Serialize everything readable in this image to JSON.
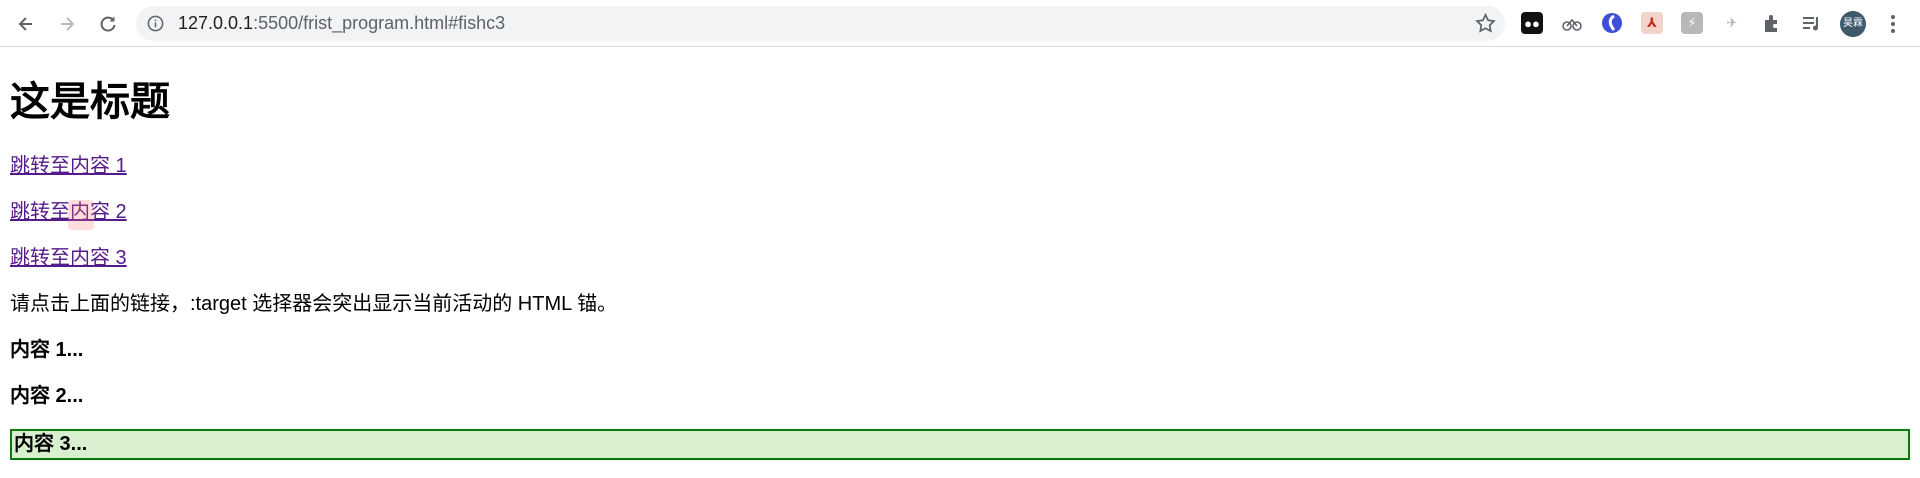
{
  "browser": {
    "url_host": "127.0.0.1",
    "url_rest": ":5500/frist_program.html#fishc3",
    "avatar_text": "昊霖",
    "icons": [
      "back-icon",
      "forward-icon",
      "reload-icon",
      "info-icon",
      "star-icon",
      "extension-1-icon",
      "extension-2-icon",
      "extension-3-icon",
      "pdf-icon",
      "extension-5-icon",
      "extension-6-icon",
      "puzzle-icon",
      "playlist-icon",
      "menu-icon"
    ]
  },
  "page": {
    "title": "这是标题",
    "links": [
      "跳转至内容 1",
      "跳转至内容 2",
      "跳转至内容 3"
    ],
    "description": "请点击上面的链接，:target 选择器会突出显示当前活动的 HTML 锚。",
    "content1": "内容 1...",
    "content2": "内容 2...",
    "content3": "内容 3..."
  },
  "colors": {
    "link": "#551a8b",
    "target_border": "#0b7a0b",
    "target_background": "#d8f0d0"
  }
}
